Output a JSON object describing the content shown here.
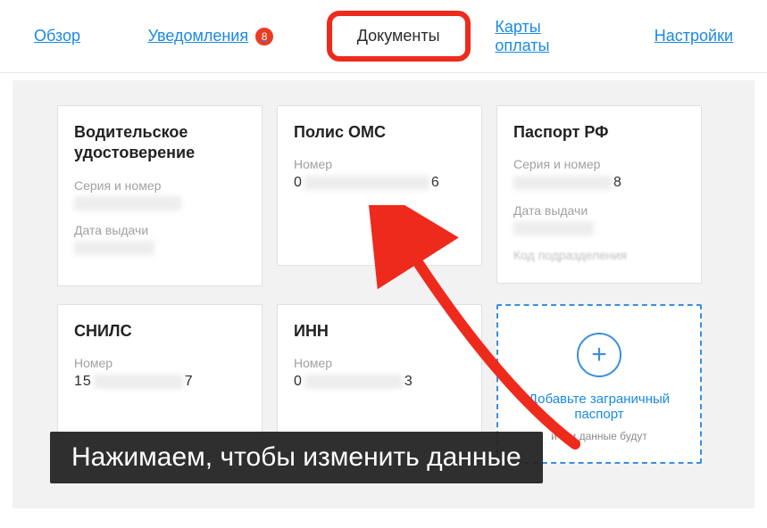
{
  "nav": {
    "overview": "Обзор",
    "notifications": "Уведомления",
    "notifications_badge": "8",
    "documents": "Документы",
    "payment_cards": "Карты оплаты",
    "settings": "Настройки"
  },
  "cards": {
    "driver": {
      "title": "Водительское удостоверение",
      "series_label": "Серия и номер",
      "date_label": "Дата выдачи"
    },
    "oms": {
      "title": "Полис ОМС",
      "number_label": "Номер",
      "value_start": "0",
      "value_end": "6"
    },
    "passport": {
      "title": "Паспорт РФ",
      "series_label": "Серия и номер",
      "value_end": "8",
      "date_label": "Дата выдачи",
      "dept_label": "Код подразделения"
    },
    "snils": {
      "title": "СНИЛС",
      "number_label": "Номер",
      "value_start": "15",
      "value_end": "7"
    },
    "inn": {
      "title": "ИНН",
      "number_label": "Номер",
      "value_start": "0",
      "value_end": "3"
    },
    "add": {
      "title": "Добавьте заграничный паспорт",
      "sub": "и эти данные будут"
    }
  },
  "caption": "Нажимаем, чтобы изменить данные"
}
